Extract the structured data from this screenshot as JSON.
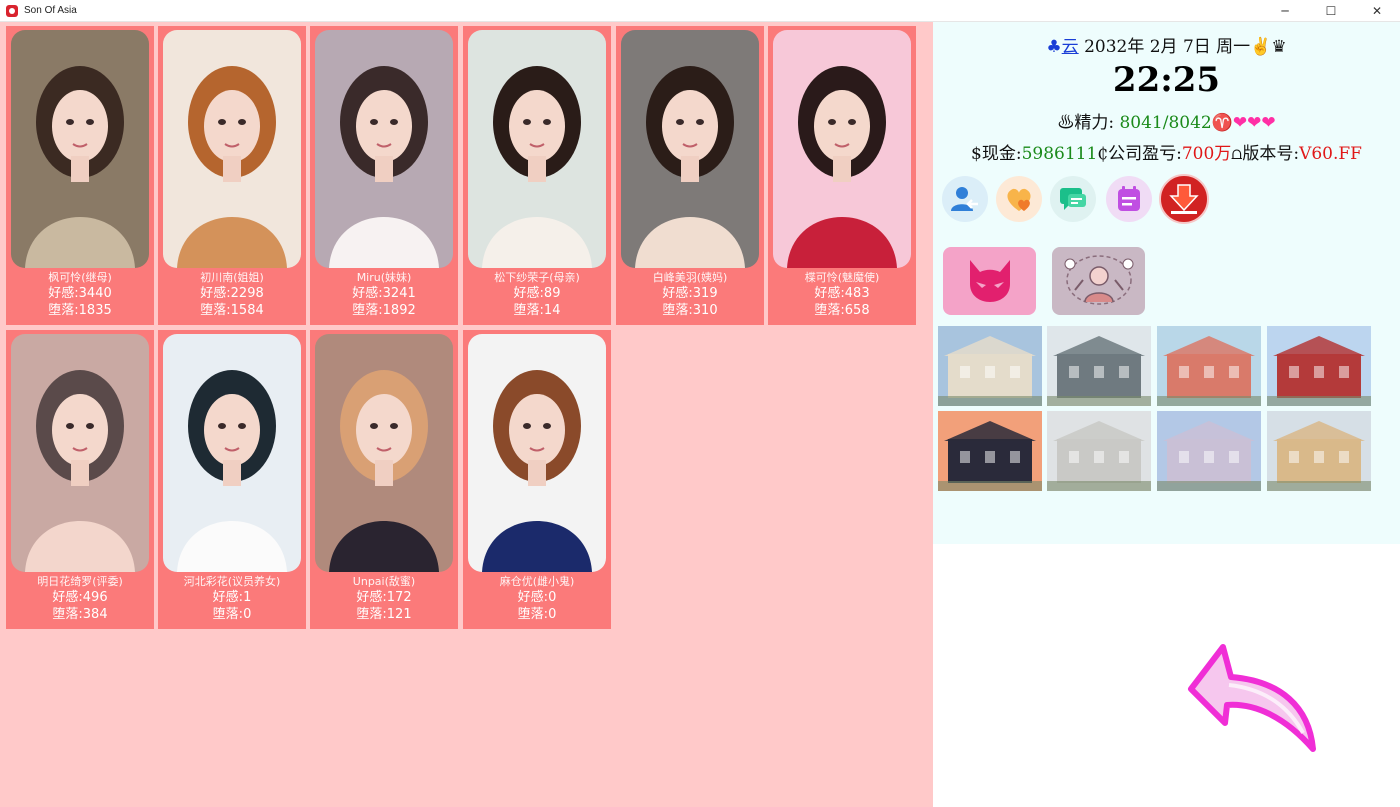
{
  "window": {
    "title": "Son Of Asia",
    "controls": {
      "minimize": "─",
      "maximize": "☐",
      "close": "✕"
    }
  },
  "characters": [
    {
      "name": "枫可怜(继母)",
      "affection_label": "好感",
      "affection": "3440",
      "corruption_label": "堕落",
      "corruption": "1835",
      "palette": [
        "#8a7a66",
        "#c9b9a0",
        "#3b2a22"
      ]
    },
    {
      "name": "初川南(姐姐)",
      "affection_label": "好感",
      "affection": "2298",
      "corruption_label": "堕落",
      "corruption": "1584",
      "palette": [
        "#f1e6dc",
        "#d4925a",
        "#b5652e"
      ]
    },
    {
      "name": "Miru(妹妹)",
      "affection_label": "好感",
      "affection": "3241",
      "corruption_label": "堕落",
      "corruption": "1892",
      "palette": [
        "#b7a9b3",
        "#f7f2f2",
        "#3a2a2a"
      ]
    },
    {
      "name": "松下纱荣子(母亲)",
      "affection_label": "好感",
      "affection": "89",
      "corruption_label": "堕落",
      "corruption": "14",
      "palette": [
        "#dde4e0",
        "#f5f0ea",
        "#2a1c18"
      ]
    },
    {
      "name": "白峰美羽(姨妈)",
      "affection_label": "好感",
      "affection": "319",
      "corruption_label": "堕落",
      "corruption": "310",
      "palette": [
        "#7e7a78",
        "#f0ddd0",
        "#2b1d18"
      ]
    },
    {
      "name": "楪可怜(魅魔使)",
      "affection_label": "好感",
      "affection": "483",
      "corruption_label": "堕落",
      "corruption": "658",
      "palette": [
        "#f7c8d8",
        "#c8203a",
        "#2a1a1a"
      ]
    },
    {
      "name": "明日花绮罗(评委)",
      "affection_label": "好感",
      "affection": "496",
      "corruption_label": "堕落",
      "corruption": "384",
      "palette": [
        "#c9a9a3",
        "#f3d6cc",
        "#5a4a4a"
      ]
    },
    {
      "name": "河北彩花(议员养女)",
      "affection_label": "好感",
      "affection": "1",
      "corruption_label": "堕落",
      "corruption": "0",
      "palette": [
        "#e8eef3",
        "#fbfbfb",
        "#1e2a33"
      ]
    },
    {
      "name": "Unpai(敌蜜)",
      "affection_label": "好感",
      "affection": "172",
      "corruption_label": "堕落",
      "corruption": "121",
      "palette": [
        "#b08a7c",
        "#2a2430",
        "#d9a074"
      ]
    },
    {
      "name": "麻仓优(雌小鬼)",
      "affection_label": "好感",
      "affection": "0",
      "corruption_label": "堕落",
      "corruption": "0",
      "palette": [
        "#f3f3f3",
        "#1b2a6b",
        "#8a4a2a"
      ]
    }
  ],
  "status": {
    "weather_icon": "♣",
    "weather": "云",
    "date": "2032年 2月 7日 周一",
    "date_suffix": "✌♛",
    "time": "22:25",
    "energy_prefix": "♨精力: ",
    "energy": "8041/8042",
    "energy_sign": "♈",
    "hearts": "❤❤❤",
    "cash_label": "$现金:",
    "cash": "5986111",
    "profit_label": "₵公司盈亏:",
    "profit": "700万",
    "version_label": "⩍版本号:",
    "version": "V60.FF"
  },
  "toolbar_icons": [
    {
      "name": "contacts-icon",
      "color": "#2f7fd8",
      "bg": "#dbeef8"
    },
    {
      "name": "favorite-heart-icon",
      "color": "#f3a23a",
      "bg": "#fde9d6"
    },
    {
      "name": "chat-icon",
      "color": "#1bbf8a",
      "bg": "#dff2f1"
    },
    {
      "name": "calendar-icon",
      "color": "#c04fe2",
      "bg": "#f0dcf5"
    },
    {
      "name": "download-icon",
      "color": "#e01818",
      "bg": "#d12222",
      "label": "DOWNLOAD"
    }
  ],
  "big_buttons": [
    {
      "name": "demon-mode-icon",
      "color": "#e2206e",
      "bg": "#f4a3c8"
    },
    {
      "name": "social-network-icon",
      "color": "#7a5c6a",
      "bg": "#c9b8c4"
    }
  ],
  "locations": [
    {
      "name": "mansion-thumb",
      "sky": "#a8c4de",
      "main": "#e4dccb"
    },
    {
      "name": "mall-interior-thumb",
      "sky": "#dfe6ea",
      "main": "#6f7a80"
    },
    {
      "name": "hospital-thumb",
      "sky": "#b9d7e8",
      "main": "#d97a6a"
    },
    {
      "name": "red-building-thumb",
      "sky": "#bcd5ef",
      "main": "#b43a3a"
    },
    {
      "name": "city-skyline-thumb",
      "sky": "#f2a07a",
      "main": "#2a2a3a"
    },
    {
      "name": "bank-thumb",
      "sky": "#dfe2e4",
      "main": "#c9c9c6"
    },
    {
      "name": "townhouse-thumb",
      "sky": "#b3c8e6",
      "main": "#c9c0d6"
    },
    {
      "name": "beach-pier-thumb",
      "sky": "#d6dfe6",
      "main": "#d9b98a"
    }
  ],
  "colors": {
    "left_bg": "#ffc9c9",
    "card_bg": "#fb7a7a",
    "right_bg": "#eefdfd",
    "back_arrow": "#f02ed6"
  }
}
